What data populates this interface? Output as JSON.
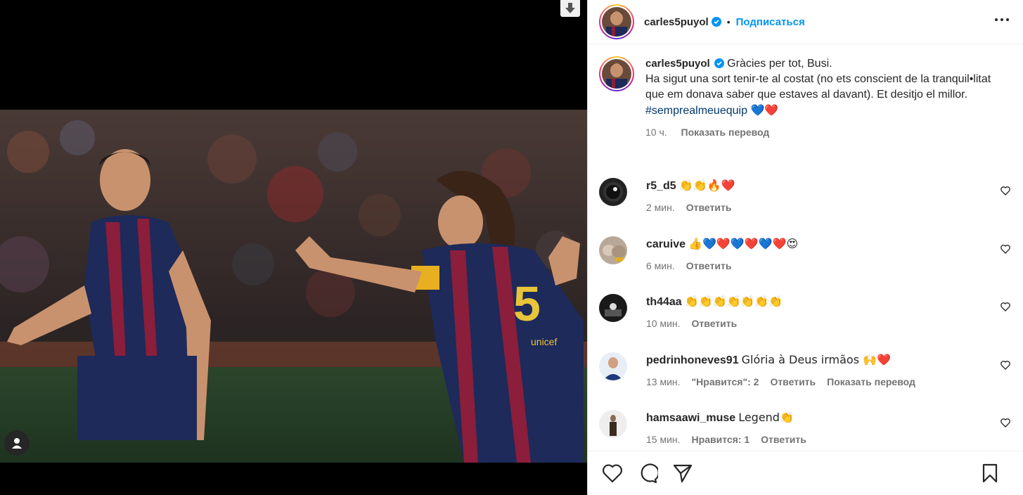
{
  "post": {
    "author": "carles5puyol",
    "follow_label": "Подписаться",
    "caption_lines": [
      "Gràcies per tot, Busi.",
      "Ha sigut una sort tenir-te al costat (no ets conscient de la tranquil•litat que em donava saber que estaves al davant). Et desitjo el millor."
    ],
    "hashtag": "#semprealmeuequip",
    "hashtag_emojis": "💙❤️",
    "time": "10 ч.",
    "translate_label": "Показать перевод"
  },
  "comments": [
    {
      "user": "r5_d5",
      "text": "👏👏🔥❤️",
      "time": "2 мин.",
      "likes": "",
      "reply": "Ответить",
      "translate": ""
    },
    {
      "user": "caruive",
      "text": "👍💙❤️💙❤️💙❤️😍",
      "time": "6 мин.",
      "likes": "",
      "reply": "Ответить",
      "translate": ""
    },
    {
      "user": "th44aa",
      "text": "👏👏👏👏👏👏👏",
      "time": "10 мин.",
      "likes": "",
      "reply": "Ответить",
      "translate": ""
    },
    {
      "user": "pedrinhoneves91",
      "text": "Glória à Deus irmãos 🙌❤️",
      "time": "13 мин.",
      "likes": "\"Нравится\": 2",
      "reply": "Ответить",
      "translate": "Показать перевод"
    },
    {
      "user": "hamsaawi_muse",
      "text": "Legend👏",
      "time": "15 мин.",
      "likes": "Нравится: 1",
      "reply": "Ответить",
      "translate": ""
    }
  ],
  "colors": {
    "accent": "#0095f6",
    "hashtag": "#00376b",
    "secondary_text": "#737373",
    "verified": "#0095f6"
  },
  "icons": {
    "download": "download-arrow-icon",
    "user_tag": "user-tag-icon",
    "more": "more-options-icon",
    "like": "heart-icon",
    "comment": "comment-icon",
    "share": "share-icon",
    "save": "bookmark-icon"
  }
}
